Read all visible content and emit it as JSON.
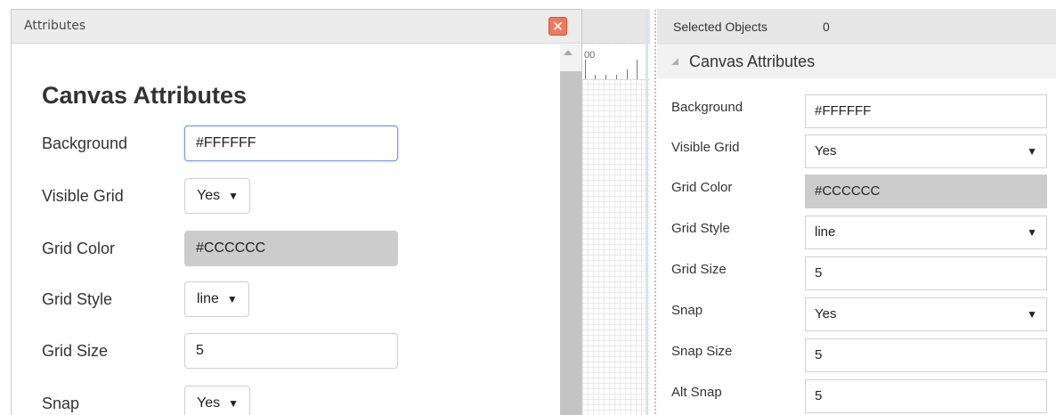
{
  "dialog": {
    "title": "Attributes",
    "close_glyph": "×",
    "heading": "Canvas Attributes",
    "fields": {
      "background": {
        "label": "Background",
        "value": "#FFFFFF"
      },
      "visible_grid": {
        "label": "Visible Grid",
        "value": "Yes"
      },
      "grid_color": {
        "label": "Grid Color",
        "value": "#CCCCCC"
      },
      "grid_style": {
        "label": "Grid Style",
        "value": "line"
      },
      "grid_size": {
        "label": "Grid Size",
        "value": "5"
      },
      "snap": {
        "label": "Snap",
        "value": "Yes"
      }
    }
  },
  "canvas": {
    "ruler_label": "00"
  },
  "panel": {
    "header": {
      "label": "Selected Objects",
      "count": "0"
    },
    "section": {
      "label": "Canvas Attributes"
    },
    "fields": {
      "background": {
        "label": "Background",
        "value": "#FFFFFF"
      },
      "visible_grid": {
        "label": "Visible Grid",
        "value": "Yes"
      },
      "grid_color": {
        "label": "Grid Color",
        "value": "#CCCCCC"
      },
      "grid_style": {
        "label": "Grid Style",
        "value": "line"
      },
      "grid_size": {
        "label": "Grid Size",
        "value": "5"
      },
      "snap": {
        "label": "Snap",
        "value": "Yes"
      },
      "snap_size": {
        "label": "Snap Size",
        "value": "5"
      },
      "alt_snap": {
        "label": "Alt Snap",
        "value": "5"
      }
    }
  },
  "icons": {
    "close": "close-icon",
    "caret": "caret-down-icon",
    "collapse": "collapse-triangle-icon",
    "scroll_up": "scroll-up-icon"
  },
  "colors": {
    "close_button": "#ee7a5b",
    "disabled_field": "#cccccc",
    "focus_border": "#6f9fe0"
  }
}
